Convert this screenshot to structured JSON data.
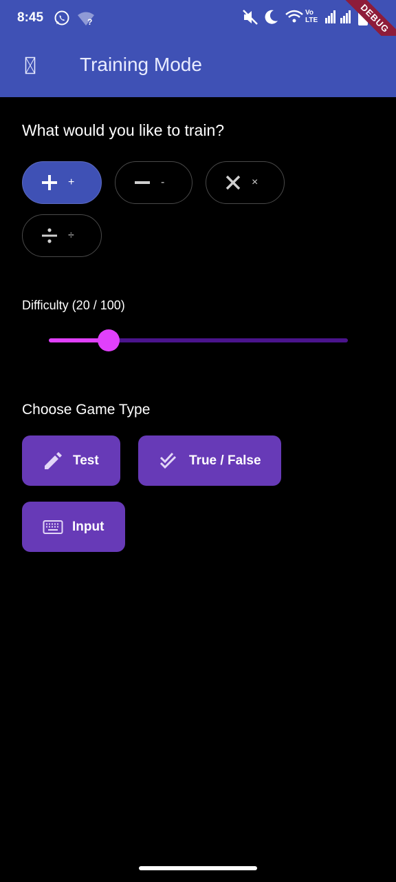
{
  "status_bar": {
    "time": "8:45",
    "left_icons": [
      "whatsapp-icon",
      "wifi-question-icon"
    ],
    "right_icons": [
      "mute-icon",
      "moon-icon",
      "wifi-icon",
      "volte-icon",
      "signal-icon",
      "signal-icon",
      "battery-icon"
    ],
    "volte_line1": "Vo",
    "volte_line2": "LTE",
    "debug_banner": "DEBUG"
  },
  "app_bar": {
    "title": "Training Mode",
    "menu_icon": "missing-glyph-icon",
    "color": "#3f51b5"
  },
  "train_section": {
    "heading": "What would you like to train?",
    "chips": [
      {
        "icon": "plus-icon",
        "label": "+",
        "selected": true
      },
      {
        "icon": "minus-icon",
        "label": "-",
        "selected": false
      },
      {
        "icon": "multiply-icon",
        "label": "×",
        "selected": false
      },
      {
        "icon": "divide-icon",
        "label": "÷",
        "selected": false
      }
    ]
  },
  "difficulty": {
    "label": "Difficulty (20 / 100)",
    "value": 20,
    "max": 100,
    "active_color": "#e040fb",
    "inactive_color": "#4a148c"
  },
  "game_type": {
    "heading": "Choose Game Type",
    "buttons": [
      {
        "icon": "pencil-icon",
        "label": "Test"
      },
      {
        "icon": "double-check-icon",
        "label": "True / False"
      },
      {
        "icon": "keyboard-icon",
        "label": "Input"
      }
    ],
    "color": "#673ab7"
  }
}
